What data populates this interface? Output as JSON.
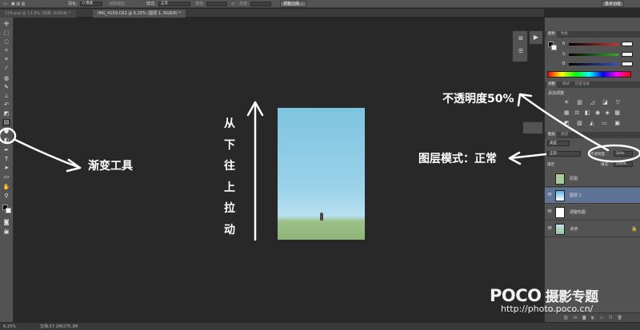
{
  "options_bar": {
    "feather_label": "羽化:",
    "feather_value": "0 像素",
    "antialias_label": "消除锯齿",
    "style_label": "样式:",
    "style_value": "正常",
    "width_label": "宽度:",
    "height_label": "高度:",
    "refine_edge_button": "调整边缘...",
    "workspace_button": "基本功能"
  },
  "tabs": [
    {
      "label": "159.psd @ 13.9% (背景, RGB/8) *"
    },
    {
      "label": "IMG_4159.CR2 @ 6.25% (图层 1, RGB/8) *"
    }
  ],
  "annotations": {
    "gradient_tool": "渐变工具",
    "drag_up_chars": [
      "从",
      "下",
      "往",
      "上",
      "拉",
      "动"
    ],
    "opacity_note": "不透明度50%",
    "blend_mode_note": "图层模式：正常"
  },
  "color_panel": {
    "tabs": [
      "颜色",
      "色板"
    ],
    "sliders": [
      {
        "label": "R",
        "color": "#d43030"
      },
      {
        "label": "G",
        "color": "#30b030"
      },
      {
        "label": "B",
        "color": "#3050d8"
      }
    ]
  },
  "adjustments_panel": {
    "tabs": [
      "调整",
      "样式",
      "历史记录"
    ],
    "title": "添加调整"
  },
  "layers_panel": {
    "tabs": [
      "图层",
      "通道"
    ],
    "filter_label": "类型",
    "blend_mode": "正常",
    "opacity_label": "不透明度:",
    "opacity_value": "50%",
    "lock_label": "锁定:",
    "fill_label": "填充:",
    "fill_value": "100%",
    "layers": [
      {
        "name": "原图",
        "thumb_color": "#a8c998",
        "selected": false
      },
      {
        "name": "图层 1",
        "thumb_color": "#5ab6e6",
        "selected": true
      },
      {
        "name": "调整构图",
        "thumb_color": "#ffffff",
        "selected": false
      },
      {
        "name": "背景",
        "thumb_color": "#9cc59a",
        "selected": false
      }
    ],
    "footer_icons": [
      "link-icon",
      "fx-icon",
      "mask-icon",
      "adjust-icon",
      "folder-icon",
      "new-layer-icon",
      "trash-icon"
    ]
  },
  "status_bar": {
    "zoom": "6.25%",
    "doc_info": "文档:57.1M/275.3M"
  },
  "watermark": {
    "brand": "POCO",
    "tagline": "摄影专题",
    "url": "http://photo.poco.cn/"
  },
  "colors": {
    "accent_selection": "#5f7396",
    "ui_gray": "#535353",
    "canvas_bg": "#282828"
  }
}
